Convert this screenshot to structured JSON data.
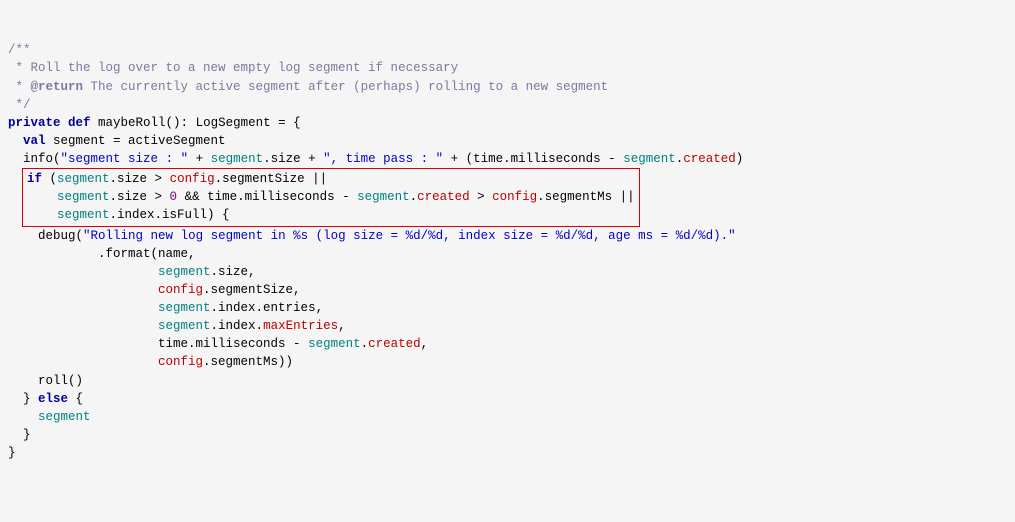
{
  "comment": {
    "open": "/**",
    "line1": " * Roll the log over to a new empty log segment if necessary",
    "line2_pre": " * ",
    "tag": "@return",
    "line2_post": " The currently active segment after (perhaps) rolling to a new segment",
    "close": " */"
  },
  "l3": {
    "kw_private": "private",
    "kw_def": "def",
    "name": " maybeRoll(): LogSegment = {"
  },
  "l4": {
    "kw_val": "val",
    "rest": " segment = activeSegment"
  },
  "l5": {
    "fn": "info",
    "p_open": "(",
    "s1": "\"segment size : \"",
    "plus1": " + ",
    "seg1": "segment",
    "dot_size1": ".size + ",
    "s2": "\", time pass : \"",
    "plus2": " + (time.milliseconds - ",
    "seg2": "segment",
    "dot": ".",
    "created": "created",
    "close": ")"
  },
  "hl": {
    "l1": {
      "kw_if": "if",
      "open": " (",
      "seg": "segment",
      "rest1": ".size > ",
      "cfg": "config",
      "rest2": ".segmentSize ||"
    },
    "l2": {
      "pad": "    ",
      "seg": "segment",
      "t1": ".size > ",
      "zero": "0",
      "t2": " && time.milliseconds - ",
      "seg2": "segment",
      "dot": ".",
      "created": "created",
      "gt": " > ",
      "cfg": "config",
      "t3": ".segmentMs ||"
    },
    "l3": {
      "pad": "    ",
      "seg": "segment",
      "rest": ".index.isFull) {"
    }
  },
  "dbg": {
    "pad": "    ",
    "fn": "debug",
    "open": "(",
    "str": "\"Rolling new log segment in %s (log size = %d/%d, index size = %d/%d, age ms = %d/%d).\"",
    "fmt_pad": "            ",
    "fmt": ".format(name,",
    "arg_pad": "                    ",
    "a1_seg": "segment",
    "a1_rest": ".size,",
    "a2_cfg": "config",
    "a2_rest": ".segmentSize,",
    "a3_seg": "segment",
    "a3_rest": ".index.entries,",
    "a4_seg": "segment",
    "a4_mid": ".index.",
    "a4_max": "maxEntries",
    "a4_end": ",",
    "a5_pre": "time.milliseconds - ",
    "a5_seg": "segment",
    "a5_dot": ".",
    "a5_created": "created",
    "a5_end": ",",
    "a6_cfg": "config",
    "a6_rest": ".segmentMs))"
  },
  "tail": {
    "roll": "    roll()",
    "close_if": "  } ",
    "kw_else": "else",
    "open_else": " {",
    "seg_line_pad": "    ",
    "seg": "segment",
    "close_else": "  }",
    "close_fn": "}"
  }
}
